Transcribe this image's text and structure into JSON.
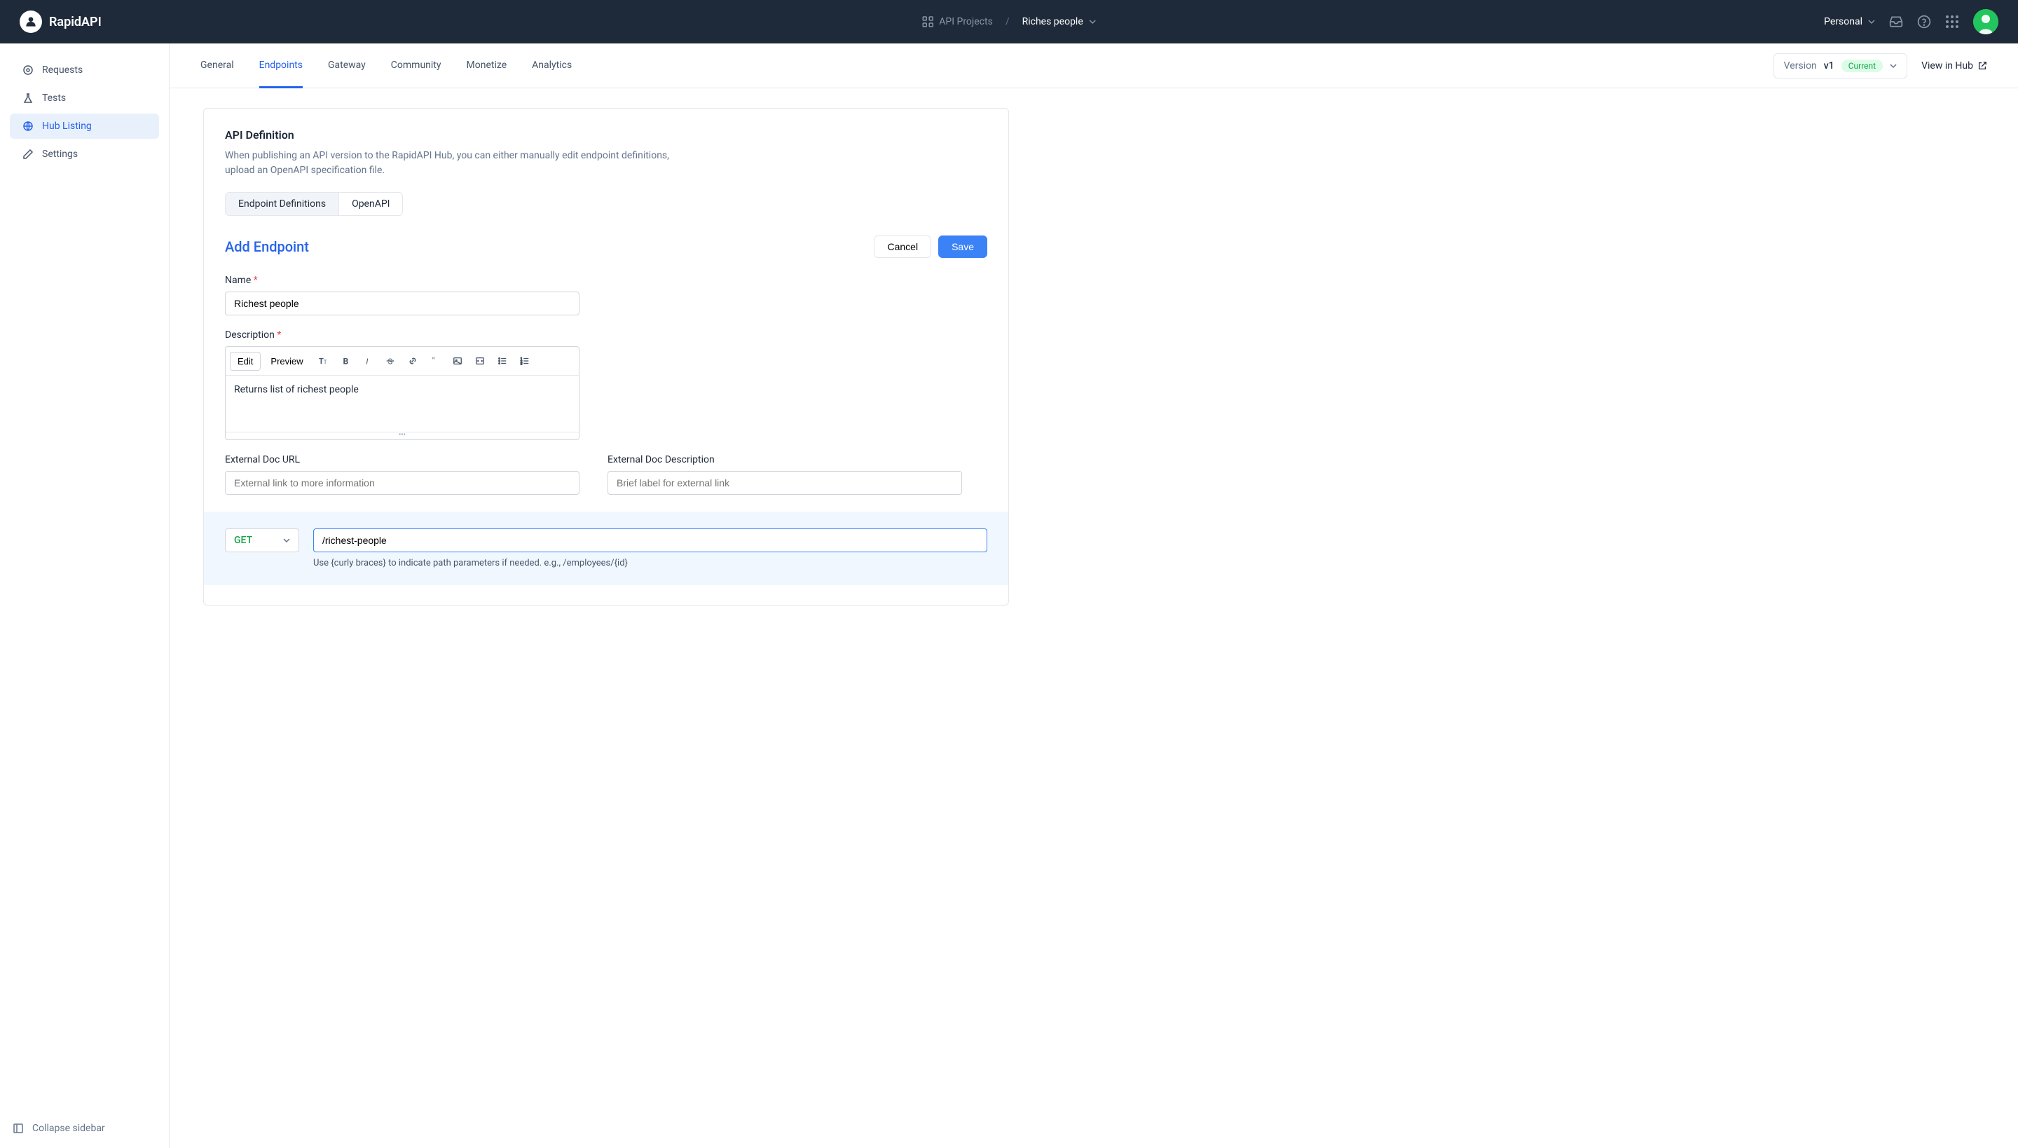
{
  "header": {
    "brand": "RapidAPI",
    "breadcrumb_root": "API Projects",
    "breadcrumb_current": "Riches people",
    "workspace": "Personal"
  },
  "sidebar": {
    "items": [
      {
        "label": "Requests"
      },
      {
        "label": "Tests"
      },
      {
        "label": "Hub Listing"
      },
      {
        "label": "Settings"
      }
    ],
    "collapse": "Collapse sidebar"
  },
  "tabs": {
    "items": [
      {
        "label": "General"
      },
      {
        "label": "Endpoints"
      },
      {
        "label": "Gateway"
      },
      {
        "label": "Community"
      },
      {
        "label": "Monetize"
      },
      {
        "label": "Analytics"
      }
    ]
  },
  "version": {
    "label": "Version",
    "value": "v1",
    "badge": "Current"
  },
  "view_hub": "View in Hub",
  "section": {
    "title": "API Definition",
    "description": "When publishing an API version to the RapidAPI Hub, you can either manually edit endpoint definitions, upload an OpenAPI specification file."
  },
  "sub_tabs": {
    "items": [
      {
        "label": "Endpoint Definitions"
      },
      {
        "label": "OpenAPI"
      }
    ]
  },
  "form": {
    "title": "Add Endpoint",
    "cancel": "Cancel",
    "save": "Save",
    "name_label": "Name",
    "name_value": "Richest people",
    "desc_label": "Description",
    "edit_btn": "Edit",
    "preview_btn": "Preview",
    "desc_value": "Returns list of richest people",
    "ext_url_label": "External Doc URL",
    "ext_url_placeholder": "External link to more information",
    "ext_desc_label": "External Doc Description",
    "ext_desc_placeholder": "Brief label for external link"
  },
  "endpoint": {
    "method": "GET",
    "path": "/richest-people",
    "hint": "Use {curly braces} to indicate path parameters if needed. e.g., /employees/{id}"
  }
}
